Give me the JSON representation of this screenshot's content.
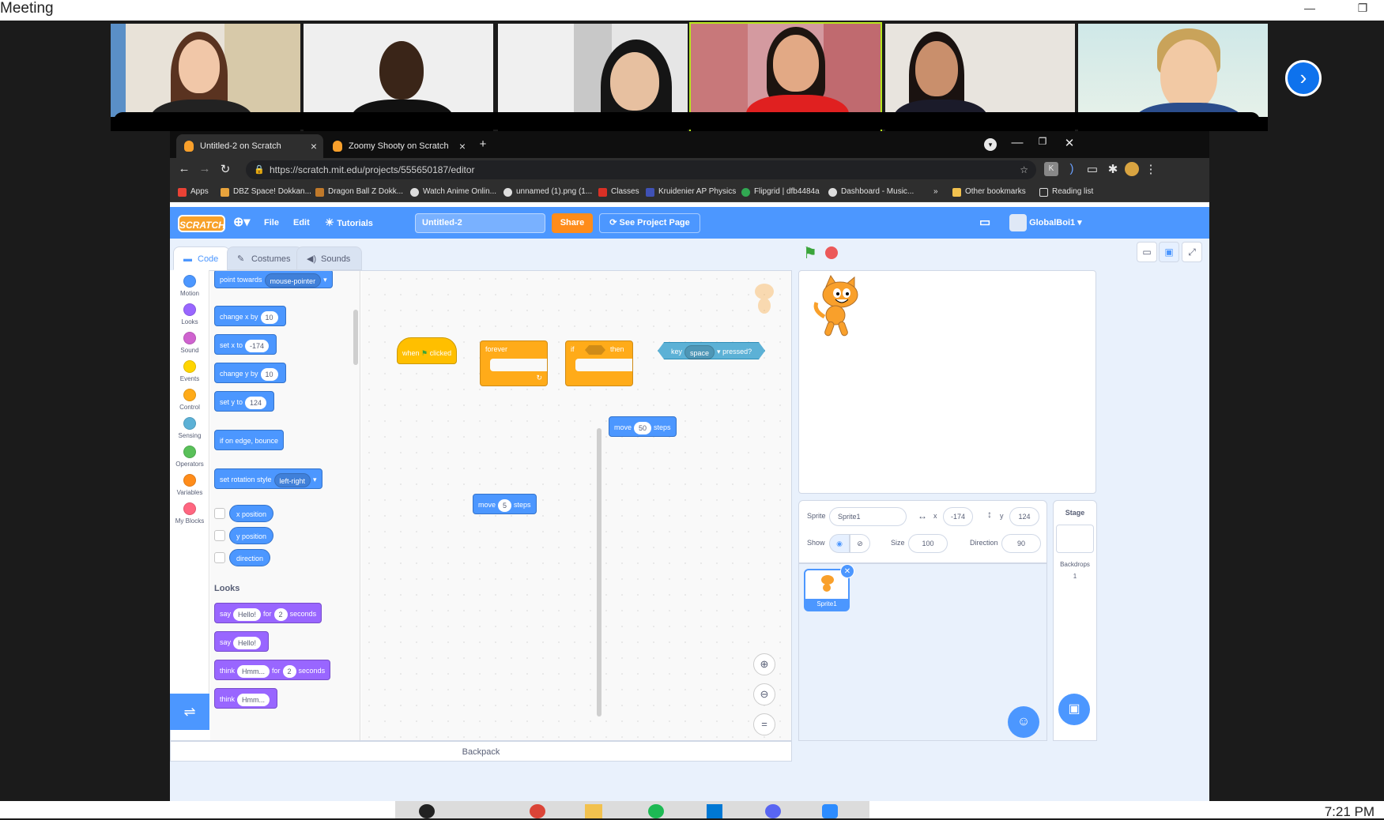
{
  "zoom": {
    "window_title": "Meeting",
    "minimize_glyph": "—",
    "restore_glyph": "❐",
    "next_glyph": "›"
  },
  "browser": {
    "tabs": [
      {
        "label": "Untitled-2 on Scratch",
        "active": true
      },
      {
        "label": "Zoomy Shooty on Scratch",
        "active": false
      }
    ],
    "url": "https://scratch.mit.edu/projects/555650187/editor",
    "bookmarks": [
      {
        "label": "Apps",
        "color": "#e94235"
      },
      {
        "label": "DBZ Space! Dokkan...",
        "color": "#e8a33c"
      },
      {
        "label": "Dragon Ball Z Dokk...",
        "color": "#c0792a"
      },
      {
        "label": "Watch Anime Onlin...",
        "color": "#dddddd"
      },
      {
        "label": "unnamed (1).png (1...",
        "color": "#dddddd"
      },
      {
        "label": "Classes",
        "color": "#d93025"
      },
      {
        "label": "Kruidenier AP Physics",
        "color": "#3f51b5"
      },
      {
        "label": "Flipgrid | dfb4484a",
        "color": "#31a852"
      },
      {
        "label": "Dashboard - Music...",
        "color": "#dddddd"
      }
    ],
    "more_bookmarks": "»",
    "other_bookmarks": "Other bookmarks",
    "reading_list": "Reading list"
  },
  "scratch": {
    "logo": "SCRATCH",
    "menu": {
      "file": "File",
      "edit": "Edit",
      "tutorials": "Tutorials",
      "share": "Share",
      "see_project_page": "See Project Page"
    },
    "project_title": "Untitled-2",
    "username": "GlobalBoi1",
    "editor_tabs": {
      "code": "Code",
      "costumes": "Costumes",
      "sounds": "Sounds"
    },
    "categories": [
      {
        "label": "Motion",
        "color": "#4c97ff"
      },
      {
        "label": "Looks",
        "color": "#9966ff"
      },
      {
        "label": "Sound",
        "color": "#cf63cf"
      },
      {
        "label": "Events",
        "color": "#ffd500"
      },
      {
        "label": "Control",
        "color": "#ffab19"
      },
      {
        "label": "Sensing",
        "color": "#5cb1d6"
      },
      {
        "label": "Operators",
        "color": "#59c059"
      },
      {
        "label": "Variables",
        "color": "#ff8c1a"
      },
      {
        "label": "My Blocks",
        "color": "#ff6680"
      }
    ],
    "palette": {
      "point_towards": "point towards",
      "mouse_pointer": "mouse-pointer",
      "change_x_by": "change x by",
      "change_x_val": "10",
      "set_x_to": "set x to",
      "set_x_val": "-174",
      "change_y_by": "change y by",
      "change_y_val": "10",
      "set_y_to": "set y to",
      "set_y_val": "124",
      "if_on_edge": "if on edge, bounce",
      "set_rotation_style": "set rotation style",
      "rotation_style": "left-right",
      "x_position": "x position",
      "y_position": "y position",
      "direction": "direction",
      "looks_heading": "Looks",
      "say": "say",
      "hello": "Hello!",
      "for": "for",
      "two": "2",
      "seconds": "seconds",
      "think": "think",
      "hmm": "Hmm..."
    },
    "script": {
      "when": "when",
      "clicked": "clicked",
      "forever": "forever",
      "if": "if",
      "then": "then",
      "key": "key",
      "space": "space",
      "pressed": "pressed?",
      "move": "move",
      "steps": "steps",
      "move1_val": "50",
      "move2_val": "5"
    },
    "backpack": "Backpack",
    "sprite": {
      "sprite_label": "Sprite",
      "name": "Sprite1",
      "x_label": "x",
      "x": "-174",
      "y_label": "y",
      "y": "124",
      "show_label": "Show",
      "size_label": "Size",
      "size": "100",
      "direction_label": "Direction",
      "direction": "90",
      "thumb_label": "Sprite1"
    },
    "stage_panel": {
      "title": "Stage",
      "backdrops_label": "Backdrops",
      "backdrops_count": "1"
    }
  },
  "taskbar": {
    "time": "7:21 PM"
  }
}
